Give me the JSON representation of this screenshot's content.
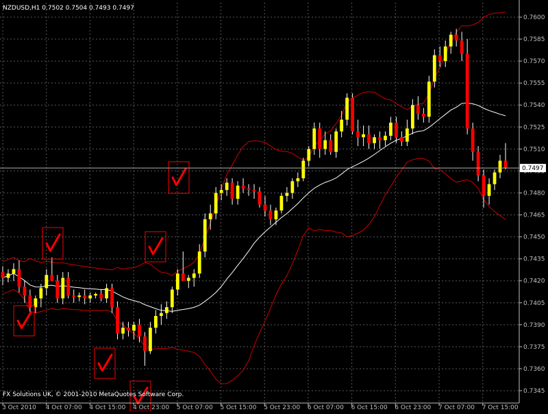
{
  "header": {
    "symbol_line": "NZDUSD,H1  0.7502 0.7504 0.7493 0.7497"
  },
  "footer": {
    "copyright": "FX Solutions UK, © 2001-2010 MetaQuotes Software Corp."
  },
  "colors": {
    "background": "#000000",
    "grid": "#5a5a5a",
    "axis": "#c0c0c0",
    "bull": "#ffff00",
    "bear": "#ff0000",
    "wick": "#ffffff",
    "band": "#d00000",
    "middle_line": "#ffffff",
    "price_line": "#b0b0b0",
    "marker": "#ff0000"
  },
  "icons": {
    "signal_marker": "check-mark-icon"
  },
  "chart_data": {
    "type": "candlestick",
    "grid": true,
    "y_ticks": [
      "0.7600",
      "0.7585",
      "0.7570",
      "0.7555",
      "0.7540",
      "0.7525",
      "0.7510",
      "0.7495",
      "0.7480",
      "0.7465",
      "0.7450",
      "0.7435",
      "0.7420",
      "0.7405",
      "0.7390",
      "0.7375",
      "0.7360",
      "0.7345"
    ],
    "ylim": [
      0.734,
      0.7605
    ],
    "x_ticks": [
      "3 Oct 2010",
      "4 Oct 07:00",
      "4 Oct 15:00",
      "4 Oct 23:00",
      "5 Oct 07:00",
      "5 Oct 15:00",
      "5 Oct 23:00",
      "6 Oct 07:00",
      "6 Oct 15:00",
      "6 Oct 23:00",
      "7 Oct 07:00",
      "7 Oct 15:00"
    ],
    "current_price": "0.7497",
    "candles": [
      [
        0.7426,
        0.743,
        0.7417,
        0.7422
      ],
      [
        0.7422,
        0.7428,
        0.7419,
        0.7425
      ],
      [
        0.7425,
        0.7432,
        0.742,
        0.7428
      ],
      [
        0.7428,
        0.7434,
        0.7412,
        0.7416
      ],
      [
        0.7416,
        0.742,
        0.7405,
        0.741
      ],
      [
        0.741,
        0.7414,
        0.7398,
        0.7402
      ],
      [
        0.7402,
        0.741,
        0.7398,
        0.7408
      ],
      [
        0.7408,
        0.7418,
        0.7402,
        0.7415
      ],
      [
        0.7415,
        0.7428,
        0.741,
        0.7424
      ],
      [
        0.7424,
        0.7436,
        0.742,
        0.742
      ],
      [
        0.742,
        0.7424,
        0.7405,
        0.7408
      ],
      [
        0.7408,
        0.7426,
        0.7404,
        0.7422
      ],
      [
        0.7422,
        0.7426,
        0.7408,
        0.741
      ],
      [
        0.741,
        0.7414,
        0.7405,
        0.7409
      ],
      [
        0.7409,
        0.7412,
        0.7406,
        0.741
      ],
      [
        0.741,
        0.7414,
        0.7404,
        0.7408
      ],
      [
        0.7408,
        0.7412,
        0.7405,
        0.741
      ],
      [
        0.741,
        0.7412,
        0.7408,
        0.7411
      ],
      [
        0.7411,
        0.7414,
        0.7406,
        0.7408
      ],
      [
        0.7408,
        0.7418,
        0.7405,
        0.7415
      ],
      [
        0.7415,
        0.7418,
        0.7398,
        0.7402
      ],
      [
        0.7402,
        0.7406,
        0.738,
        0.7384
      ],
      [
        0.7384,
        0.7392,
        0.738,
        0.7388
      ],
      [
        0.7388,
        0.7392,
        0.7382,
        0.7386
      ],
      [
        0.7386,
        0.7392,
        0.738,
        0.739
      ],
      [
        0.739,
        0.7394,
        0.7378,
        0.7382
      ],
      [
        0.7382,
        0.7385,
        0.7362,
        0.7372
      ],
      [
        0.7372,
        0.7392,
        0.737,
        0.7388
      ],
      [
        0.7388,
        0.74,
        0.7384,
        0.7396
      ],
      [
        0.7396,
        0.7404,
        0.739,
        0.7398
      ],
      [
        0.7398,
        0.7406,
        0.7394,
        0.7402
      ],
      [
        0.7402,
        0.7416,
        0.7398,
        0.7414
      ],
      [
        0.7414,
        0.7428,
        0.741,
        0.7425
      ],
      [
        0.7425,
        0.744,
        0.742,
        0.742
      ],
      [
        0.742,
        0.7424,
        0.7415,
        0.7422
      ],
      [
        0.7422,
        0.7428,
        0.7416,
        0.7425
      ],
      [
        0.7425,
        0.7445,
        0.7422,
        0.744
      ],
      [
        0.744,
        0.7466,
        0.7436,
        0.7462
      ],
      [
        0.7462,
        0.7472,
        0.7455,
        0.7466
      ],
      [
        0.7466,
        0.7484,
        0.7462,
        0.748
      ],
      [
        0.748,
        0.7486,
        0.7475,
        0.7482
      ],
      [
        0.7482,
        0.749,
        0.7478,
        0.7487
      ],
      [
        0.7487,
        0.749,
        0.7472,
        0.7476
      ],
      [
        0.7476,
        0.7488,
        0.7472,
        0.7485
      ],
      [
        0.7485,
        0.749,
        0.748,
        0.7483
      ],
      [
        0.7483,
        0.7486,
        0.7478,
        0.7482
      ],
      [
        0.7482,
        0.7486,
        0.7476,
        0.7481
      ],
      [
        0.7481,
        0.7484,
        0.747,
        0.7472
      ],
      [
        0.7472,
        0.7478,
        0.7464,
        0.7468
      ],
      [
        0.7468,
        0.7472,
        0.7458,
        0.7462
      ],
      [
        0.7462,
        0.747,
        0.7458,
        0.7468
      ],
      [
        0.7468,
        0.748,
        0.7466,
        0.7478
      ],
      [
        0.7478,
        0.7484,
        0.7474,
        0.748
      ],
      [
        0.748,
        0.749,
        0.7476,
        0.7488
      ],
      [
        0.7488,
        0.7494,
        0.7484,
        0.749
      ],
      [
        0.749,
        0.7504,
        0.7488,
        0.7502
      ],
      [
        0.7502,
        0.7512,
        0.7498,
        0.751
      ],
      [
        0.751,
        0.7528,
        0.7506,
        0.7524
      ],
      [
        0.7524,
        0.7528,
        0.7504,
        0.751
      ],
      [
        0.751,
        0.7522,
        0.7506,
        0.7516
      ],
      [
        0.7516,
        0.752,
        0.7506,
        0.7508
      ],
      [
        0.7508,
        0.7524,
        0.7504,
        0.7522
      ],
      [
        0.7522,
        0.7536,
        0.7518,
        0.753
      ],
      [
        0.753,
        0.7548,
        0.7526,
        0.7545
      ],
      [
        0.7545,
        0.7548,
        0.752,
        0.7522
      ],
      [
        0.7522,
        0.753,
        0.7512,
        0.7518
      ],
      [
        0.7518,
        0.7526,
        0.7512,
        0.752
      ],
      [
        0.752,
        0.7526,
        0.751,
        0.7514
      ],
      [
        0.7514,
        0.752,
        0.751,
        0.7518
      ],
      [
        0.7518,
        0.7522,
        0.751,
        0.7516
      ],
      [
        0.7516,
        0.7522,
        0.7512,
        0.7519
      ],
      [
        0.7519,
        0.7532,
        0.7516,
        0.7528
      ],
      [
        0.7528,
        0.7532,
        0.7514,
        0.7518
      ],
      [
        0.7518,
        0.7522,
        0.7512,
        0.7515
      ],
      [
        0.7515,
        0.753,
        0.7512,
        0.7524
      ],
      [
        0.7524,
        0.7544,
        0.752,
        0.754
      ],
      [
        0.754,
        0.7546,
        0.753,
        0.7534
      ],
      [
        0.7534,
        0.7538,
        0.7528,
        0.7532
      ],
      [
        0.7532,
        0.756,
        0.7528,
        0.7556
      ],
      [
        0.7556,
        0.7578,
        0.7552,
        0.7574
      ],
      [
        0.7574,
        0.758,
        0.7566,
        0.757
      ],
      [
        0.757,
        0.7584,
        0.7566,
        0.758
      ],
      [
        0.758,
        0.759,
        0.7575,
        0.7588
      ],
      [
        0.7588,
        0.7592,
        0.758,
        0.7584
      ],
      [
        0.7584,
        0.759,
        0.757,
        0.7575
      ],
      [
        0.7575,
        0.7585,
        0.752,
        0.7524
      ],
      [
        0.7524,
        0.7528,
        0.7502,
        0.7508
      ],
      [
        0.7508,
        0.7512,
        0.7488,
        0.7492
      ],
      [
        0.7492,
        0.7496,
        0.747,
        0.7478
      ],
      [
        0.7478,
        0.749,
        0.7472,
        0.7486
      ],
      [
        0.7486,
        0.7496,
        0.7482,
        0.7494
      ],
      [
        0.7494,
        0.7506,
        0.749,
        0.7502
      ],
      [
        0.7502,
        0.7514,
        0.7496,
        0.7497
      ]
    ]
  }
}
